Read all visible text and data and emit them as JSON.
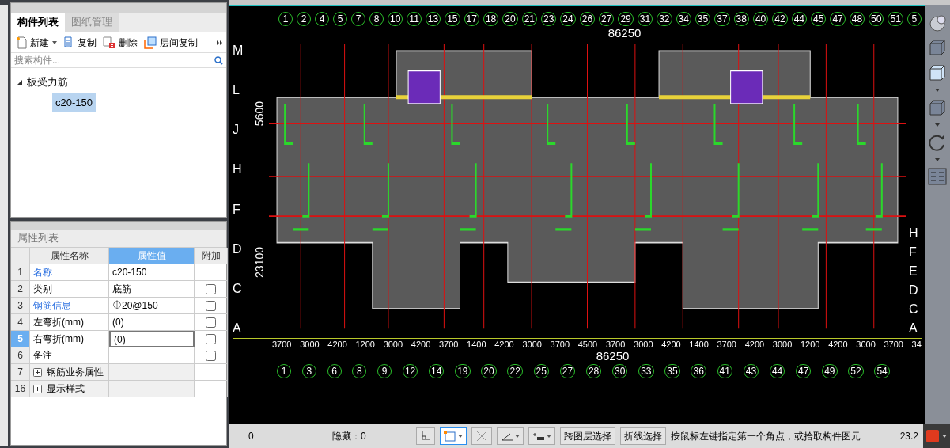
{
  "component_panel": {
    "tabs": [
      {
        "label": "构件列表",
        "selected": true
      },
      {
        "label": "图纸管理",
        "selected": false
      }
    ],
    "toolbar": [
      {
        "kind": "new",
        "label": "新建",
        "dropdown": true
      },
      {
        "kind": "copy",
        "label": "复制",
        "dropdown": false
      },
      {
        "kind": "delete",
        "label": "删除",
        "dropdown": false
      },
      {
        "kind": "floor-copy",
        "label": "层间复制",
        "dropdown": false
      }
    ],
    "search": {
      "placeholder": "搜索构件..."
    },
    "tree": [
      {
        "label": "板受力筋",
        "expanded": true,
        "selected": false,
        "children": [
          {
            "label": "c20-150",
            "selected": true
          }
        ]
      }
    ]
  },
  "property_panel": {
    "title": "属性列表",
    "columns": [
      {
        "label": "属性名称",
        "selected": false
      },
      {
        "label": "属性值",
        "selected": true
      },
      {
        "label": "附加",
        "selected": false
      }
    ],
    "rows": [
      {
        "kind": "property",
        "index": "1",
        "name": "名称",
        "link": true,
        "value": "c20-150",
        "has_checkbox": false,
        "selected": false
      },
      {
        "kind": "property",
        "index": "2",
        "name": "类别",
        "link": false,
        "value": "底筋",
        "has_checkbox": true,
        "checked": false,
        "selected": false
      },
      {
        "kind": "property",
        "index": "3",
        "name": "钢筋信息",
        "link": true,
        "value": "⏀20@150",
        "has_checkbox": true,
        "checked": false,
        "selected": false
      },
      {
        "kind": "property",
        "index": "4",
        "name": "左弯折(mm)",
        "link": false,
        "value": "(0)",
        "has_checkbox": true,
        "checked": false,
        "selected": false
      },
      {
        "kind": "property",
        "index": "5",
        "name": "右弯折(mm)",
        "link": false,
        "value": "(0)",
        "has_checkbox": true,
        "checked": false,
        "selected": true
      },
      {
        "kind": "property",
        "index": "6",
        "name": "备注",
        "link": false,
        "value": "",
        "has_checkbox": true,
        "checked": false,
        "selected": false
      },
      {
        "kind": "group",
        "index": "7",
        "name": "钢筋业务属性",
        "expanded": false,
        "selected": false
      },
      {
        "kind": "group",
        "index": "16",
        "name": "显示样式",
        "expanded": false,
        "selected": false
      }
    ]
  },
  "canvas": {
    "top_axes": [
      "1",
      "2",
      "4",
      "5",
      "7",
      "8",
      "10",
      "11",
      "13",
      "15",
      "17",
      "18",
      "20",
      "21",
      "23",
      "24",
      "26",
      "27",
      "29",
      "31",
      "32",
      "34",
      "35",
      "37",
      "38",
      "40",
      "42",
      "44",
      "45",
      "47",
      "48",
      "50",
      "51",
      "5"
    ],
    "top_total": "86250",
    "left_axes": [
      "M",
      "L",
      "J",
      "H",
      "F",
      "D",
      "C",
      "A"
    ],
    "left_dims": [
      "5600",
      "23100"
    ],
    "right_axes": [
      "H",
      "F",
      "E",
      "D",
      "C",
      "A"
    ],
    "bottom_dims": [
      "3700",
      "3000",
      "4200",
      "1200",
      "3000",
      "4200",
      "3700",
      "1400",
      "4200",
      "3000",
      "3700",
      "4500",
      "3700",
      "3000",
      "4200",
      "1400",
      "3700",
      "4200",
      "3000",
      "1200",
      "4200",
      "3000",
      "3700",
      "34"
    ],
    "bottom_total": "86250",
    "bottom_axes": [
      "1",
      "3",
      "6",
      "8",
      "9",
      "12",
      "14",
      "19",
      "20",
      "22",
      "25",
      "27",
      "28",
      "30",
      "33",
      "35",
      "36",
      "41",
      "43",
      "44",
      "47",
      "49",
      "52",
      "54"
    ]
  },
  "status_bar": {
    "count": "0",
    "hidden": "隐藏：0",
    "tools": [
      {
        "kind": "ortho",
        "selected": false,
        "dropdown": false
      },
      {
        "kind": "rect-select",
        "selected": true,
        "dropdown": true
      },
      {
        "kind": "cross",
        "selected": false,
        "dropdown": false
      },
      {
        "kind": "angle",
        "selected": false,
        "dropdown": true
      },
      {
        "kind": "offset",
        "selected": false,
        "dropdown": true
      }
    ],
    "buttons": [
      "跨图层选择",
      "折线选择"
    ],
    "hint": "按鼠标左键指定第一个角点，或拾取构件图元",
    "coordinate": "23.2"
  }
}
